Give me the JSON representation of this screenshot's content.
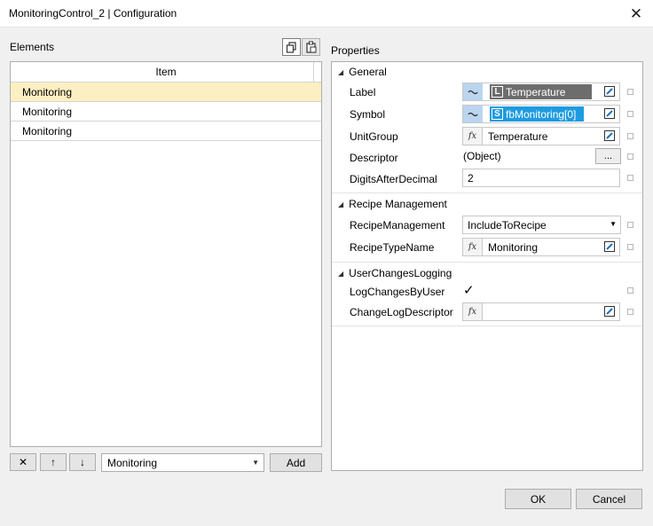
{
  "window": {
    "title": "MonitoringControl_2 | Configuration",
    "close_label": "✕"
  },
  "elements": {
    "label": "Elements",
    "column_header": "Item",
    "items": [
      "Monitoring",
      "Monitoring",
      "Monitoring"
    ],
    "selected_index": 0,
    "toolbar_icons": [
      "copy-icon",
      "paste-icon"
    ],
    "footer": {
      "delete_label": "✕",
      "up_label": "↑",
      "down_label": "↓",
      "type_value": "Monitoring",
      "add_label": "Add"
    }
  },
  "properties": {
    "label": "Properties",
    "groups": {
      "general": {
        "title": "General",
        "label_name": "Label",
        "label_badge": "L",
        "label_value": "Temperature",
        "symbol_name": "Symbol",
        "symbol_badge": "S",
        "symbol_value": "fbMonitoring[0]",
        "unitgroup_name": "UnitGroup",
        "unitgroup_value": "Temperature",
        "descriptor_name": "Descriptor",
        "descriptor_value": "(Object)",
        "descriptor_button": "...",
        "digits_name": "DigitsAfterDecimal",
        "digits_value": "2"
      },
      "recipe": {
        "title": "Recipe Management",
        "management_name": "RecipeManagement",
        "management_value": "IncludeToRecipe",
        "typename_name": "RecipeTypeName",
        "typename_value": "Monitoring"
      },
      "logging": {
        "title": "UserChangesLogging",
        "logchanges_name": "LogChangesByUser",
        "logchanges_checked": true,
        "logchanges_mark": "✓",
        "changelog_name": "ChangeLogDescriptor",
        "changelog_value": ""
      }
    }
  },
  "dialog": {
    "ok_label": "OK",
    "cancel_label": "Cancel"
  },
  "colors": {
    "selected_row": "#fcefc1",
    "label_chip": "#6d6d6d",
    "symbol_chip": "#1e9be0",
    "binding_icon_bg": "#bcd5ef"
  }
}
